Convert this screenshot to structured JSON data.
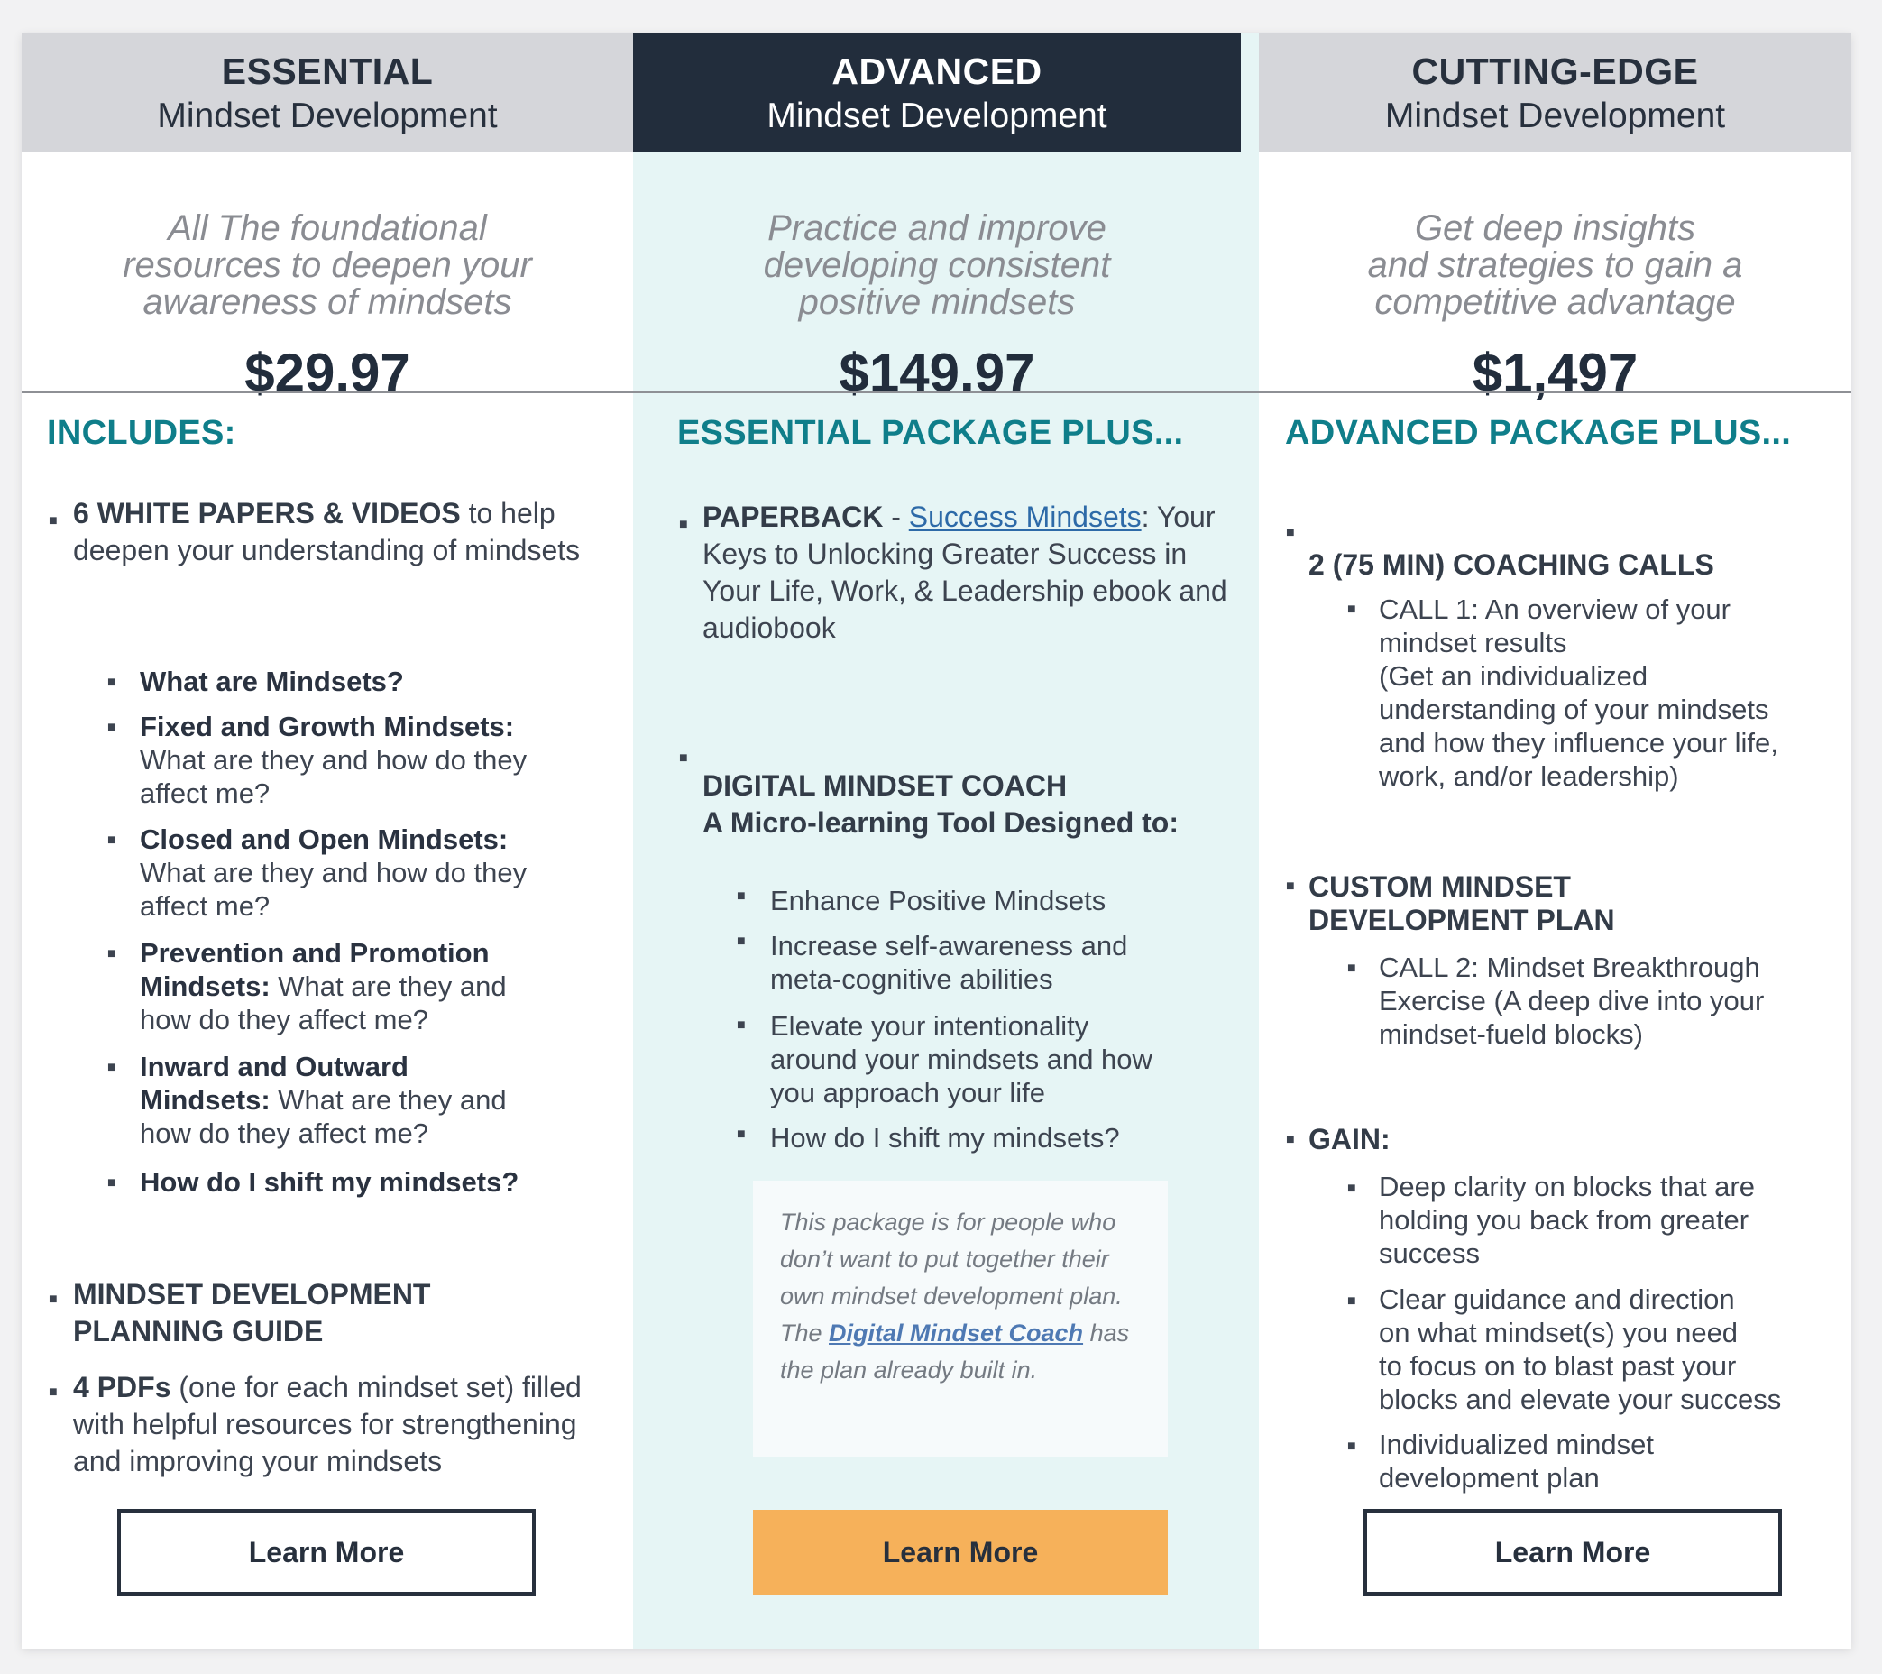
{
  "plans": [
    {
      "tier": "ESSENTIAL",
      "subtitle": "Mindset Development",
      "desc": [
        "All The foundational",
        "resources to deepen your",
        "awareness of mindsets"
      ],
      "price": "$29.97",
      "section_title": "INCLUDES:",
      "item1_bold": "6 WHITE PAPERS & VIDEOS",
      "item1_rest": " to help",
      "item1_line2": "deepen your understanding of mindsets",
      "sub": [
        {
          "bold": "What are Mindsets?"
        },
        {
          "bold": "Fixed and Growth Mindsets:",
          "rest": [
            "What are they and how do they",
            "affect me?"
          ]
        },
        {
          "bold": "Closed and Open Mindsets:",
          "rest": [
            "What are they and how do they",
            "affect me?"
          ]
        },
        {
          "bold1": "Prevention and Promotion",
          "bold2": "Mindsets:",
          "rest2": " What are they and",
          "rest3": "how do they affect me?"
        },
        {
          "bold1": "Inward and Outward",
          "bold2": "Mindsets:",
          "rest2": " What are they and",
          "rest3": "how do they affect me?"
        },
        {
          "bold": "How do I shift my mindsets?"
        }
      ],
      "item2": [
        "MINDSET DEVELOPMENT",
        "PLANNING GUIDE"
      ],
      "item3_bold": "4 PDFs",
      "item3_rest": " (one for each mindset set) filled",
      "item3_l2": "with helpful resources for strengthening",
      "item3_l3": "and improving your mindsets",
      "button": "Learn More"
    },
    {
      "tier": "ADVANCED",
      "subtitle": "Mindset Development",
      "desc": [
        "Practice and improve",
        "developing consistent",
        "positive mindsets"
      ],
      "price": "$149.97",
      "section_title": "ESSENTIAL PACKAGE PLUS...",
      "item1_bold": "PAPERBACK",
      "item1_dash": " - ",
      "item1_link": "Success Mindsets",
      "item1_rest": ": Your",
      "item1_l2": "Keys to Unlocking Greater Success in",
      "item1_l3": "Your Life, Work, & Leadership ebook and",
      "item1_l4": "audiobook",
      "item2_l1": "DIGITAL MINDSET COACH",
      "item2_l2": "A Micro-learning Tool Designed to:",
      "sub": [
        [
          "Enhance Positive Mindsets"
        ],
        [
          "Increase self-awareness and",
          "meta-cognitive abilities"
        ],
        [
          "Elevate your intentionality",
          "around your mindsets and how",
          "you approach your life"
        ],
        [
          "How do I shift my mindsets?"
        ]
      ],
      "callout_l1": "This package is for people who",
      "callout_l2": "don’t want to put together their",
      "callout_l3": "own mindset development plan.",
      "callout_pre": "The ",
      "callout_link": "Digital Mindset Coach",
      "callout_post": " has",
      "callout_l5": "the plan already built in.",
      "button": "Learn More"
    },
    {
      "tier": "CUTTING-EDGE",
      "subtitle": "Mindset Development",
      "desc": [
        "Get deep insights",
        "and strategies to gain a",
        "competitive advantage"
      ],
      "price": "$1,497",
      "section_title": "ADVANCED PACKAGE PLUS...",
      "item1": "2 (75 MIN) COACHING CALLS",
      "call1": [
        "CALL 1: An overview of your",
        "mindset results",
        "(Get an individualized",
        "understanding of your mindsets",
        "and how they influence your life,",
        "work, and/or leadership)"
      ],
      "item2": [
        "CUSTOM MINDSET",
        "DEVELOPMENT PLAN"
      ],
      "call2": [
        "CALL 2: Mindset Breakthrough",
        "Exercise (A deep dive into your",
        "mindset-fueld blocks)"
      ],
      "item3": "GAIN:",
      "gain": [
        [
          "Deep clarity on blocks that are",
          "holding you back from greater",
          "success"
        ],
        [
          "Clear guidance and direction",
          "on what mindset(s) you need",
          "to focus on to blast past your",
          "blocks and elevate your success"
        ],
        [
          "Individualized mindset",
          "development plan"
        ]
      ],
      "button": "Learn More"
    }
  ],
  "colors": {
    "dark_header": "#222d3c",
    "light_header": "#d5d6da",
    "teal": "#0f7e8a",
    "advanced_bg": "#e6f5f5",
    "button_fill": "#f6b15a"
  }
}
